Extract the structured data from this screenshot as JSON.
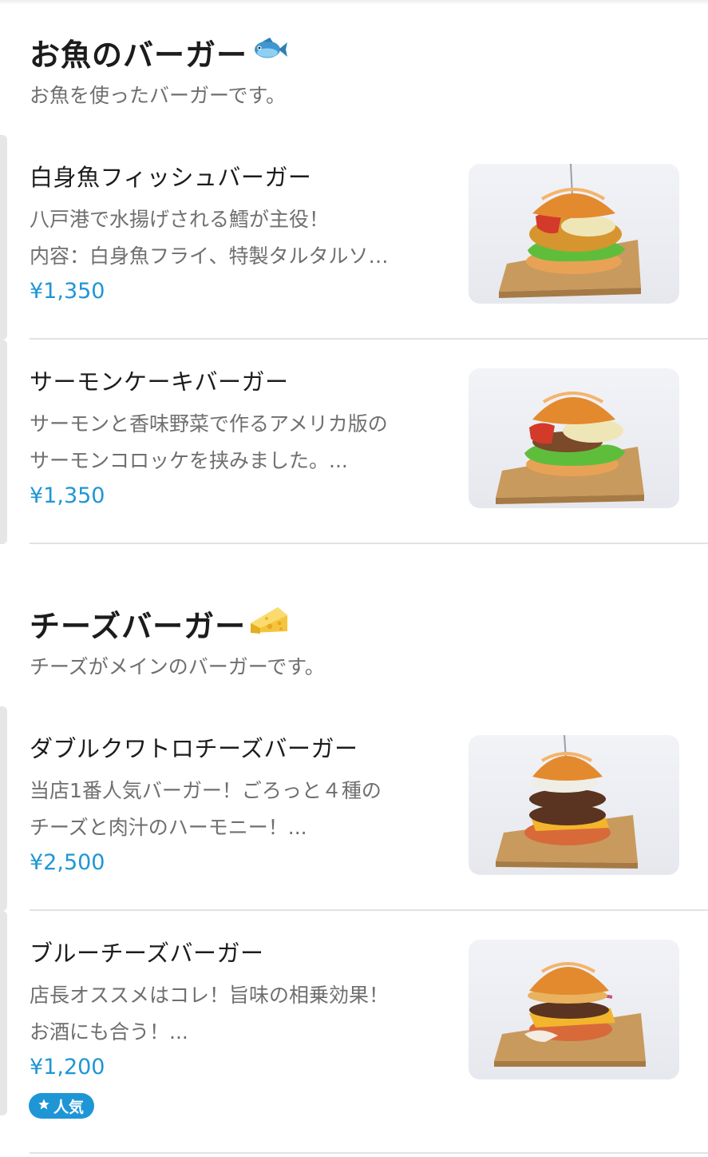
{
  "sections": [
    {
      "title": "お魚のバーガー",
      "emoji": "fish-icon",
      "subtitle": "お魚を使ったバーガーです。",
      "items": [
        {
          "name": "白身魚フィッシュバーガー",
          "desc_line1": "八戸港で水揚げされる鱈が主役！",
          "desc_line2": "内容：白身魚フライ、特製タルタルソ…",
          "price": "¥1,350"
        },
        {
          "name": "サーモンケーキバーガー",
          "desc_line1": "サーモンと香味野菜で作るアメリカ版の",
          "desc_line2": "サーモンコロッケを挟みました。...",
          "price": "¥1,350"
        }
      ]
    },
    {
      "title": "チーズバーガー",
      "emoji": "cheese-icon",
      "subtitle": "チーズがメインのバーガーです。",
      "items": [
        {
          "name": "ダブルクワトロチーズバーガー",
          "desc_line1": "当店1番人気バーガー！ごろっと４種の",
          "desc_line2": "チーズと肉汁のハーモニー！...",
          "price": "¥2,500"
        },
        {
          "name": "ブルーチーズバーガー",
          "desc_line1": "店長オススメはコレ！旨味の相乗効果！",
          "desc_line2": "お酒にも合う！...",
          "price": "¥1,200",
          "badge": "人気",
          "badge_icon": "star-icon"
        }
      ]
    }
  ],
  "colors": {
    "accent": "#1e96d6",
    "title": "#1c1c1c",
    "muted": "#6f6f6f",
    "divider": "#e2e2e2"
  }
}
